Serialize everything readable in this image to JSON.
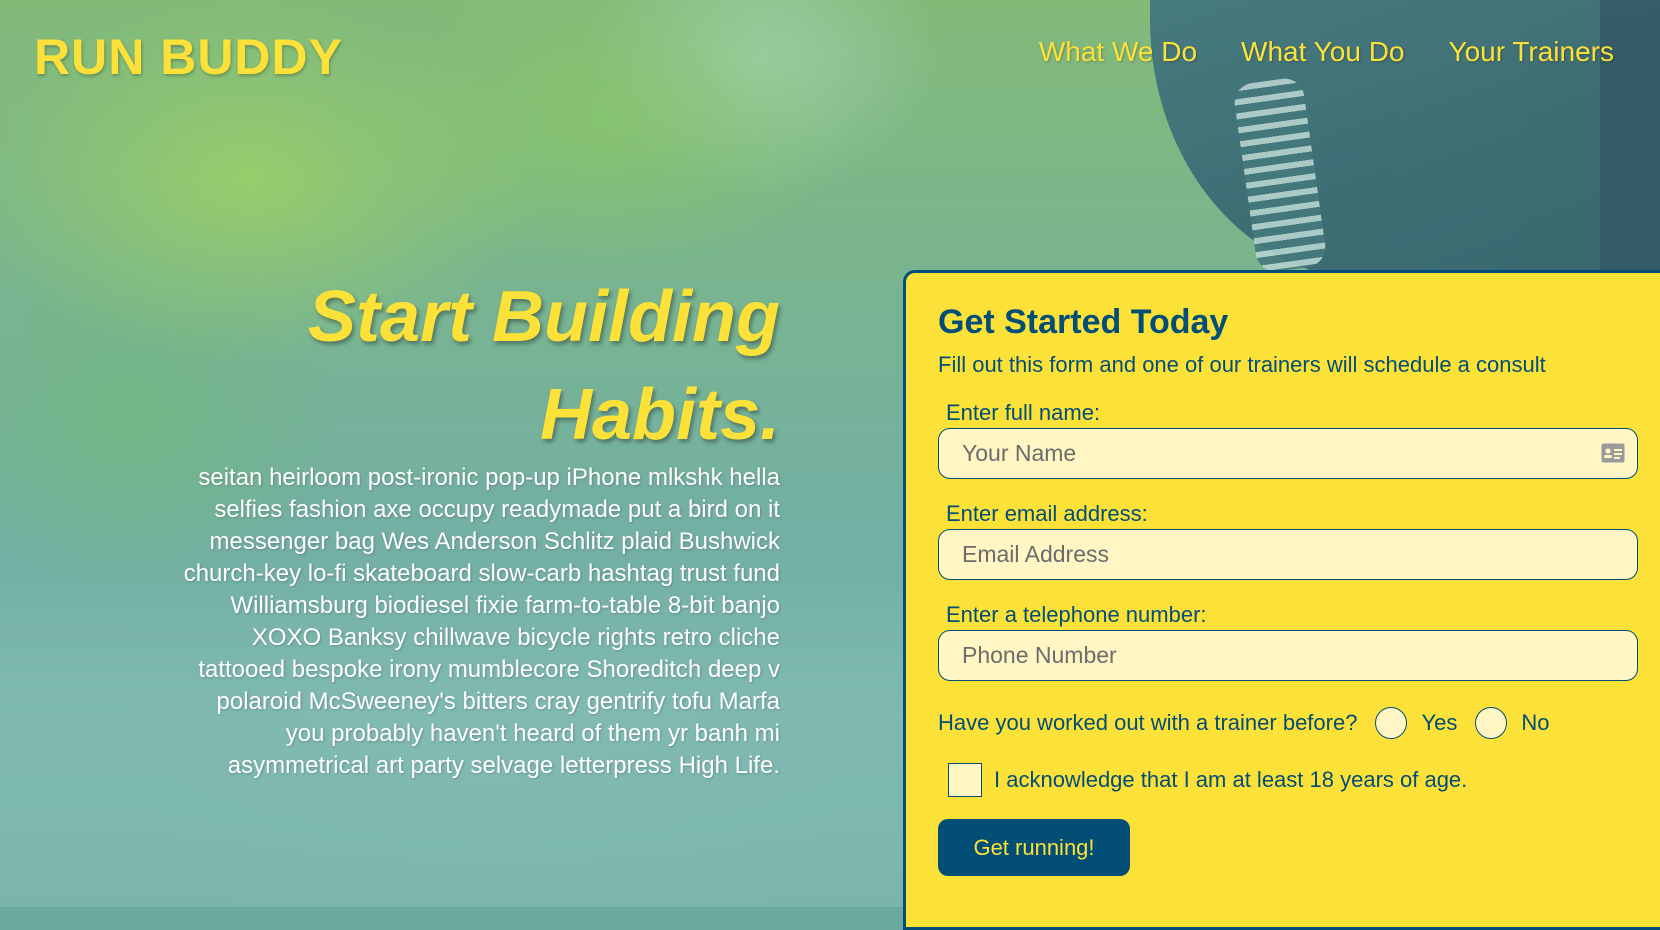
{
  "header": {
    "logo": "RUN BUDDY",
    "nav": [
      "What We Do",
      "What You Do",
      "Your Trainers"
    ]
  },
  "hero": {
    "title": "Start Building Habits.",
    "body": "seitan heirloom post-ironic pop-up iPhone mlkshk hella selfies fashion axe occupy readymade put a bird on it messenger bag Wes Anderson Schlitz plaid Bushwick church-key lo-fi skateboard slow-carb hashtag trust fund Williamsburg biodiesel fixie farm-to-table 8-bit banjo XOXO Banksy chillwave bicycle rights retro cliche tattooed bespoke irony mumblecore Shoreditch deep v polaroid McSweeney's bitters cray gentrify tofu Marfa you probably haven't heard of them yr banh mi asymmetrical art party selvage letterpress High Life."
  },
  "form": {
    "title": "Get Started Today",
    "subtitle": "Fill out this form and one of our trainers will schedule a consult",
    "name_label": "Enter full name:",
    "name_placeholder": "Your Name",
    "name_value": "",
    "email_label": "Enter email address:",
    "email_placeholder": "Email Address",
    "email_value": "",
    "phone_label": "Enter a telephone number:",
    "phone_placeholder": "Phone Number",
    "phone_value": "",
    "trainer_question": "Have you worked out with a trainer before?",
    "radio_yes": "Yes",
    "radio_no": "No",
    "age_ack": "I acknowledge that I am at least 18 years of age.",
    "submit_label": "Get running!",
    "contact_card_icon": "contact-card-icon"
  },
  "colors": {
    "brand_yellow": "#fce138",
    "brand_navy": "#024e76",
    "input_bg": "#fff6c4"
  }
}
